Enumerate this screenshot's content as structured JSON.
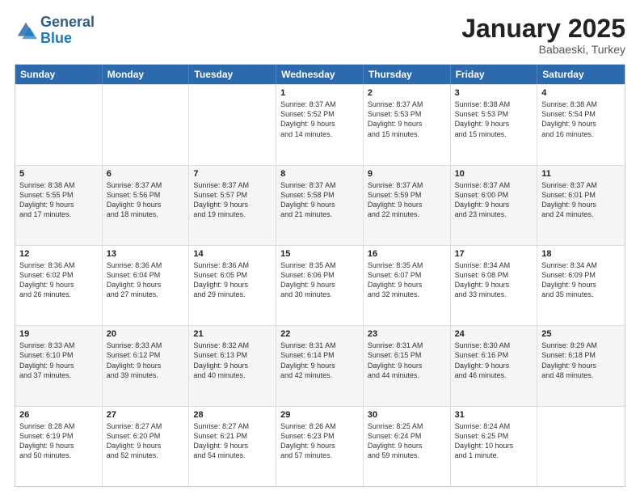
{
  "logo": {
    "general": "General",
    "blue": "Blue"
  },
  "header": {
    "month": "January 2025",
    "location": "Babaeski, Turkey"
  },
  "weekdays": [
    "Sunday",
    "Monday",
    "Tuesday",
    "Wednesday",
    "Thursday",
    "Friday",
    "Saturday"
  ],
  "rows": [
    {
      "alt": false,
      "cells": [
        {
          "day": "",
          "text": ""
        },
        {
          "day": "",
          "text": ""
        },
        {
          "day": "",
          "text": ""
        },
        {
          "day": "1",
          "text": "Sunrise: 8:37 AM\nSunset: 5:52 PM\nDaylight: 9 hours\nand 14 minutes."
        },
        {
          "day": "2",
          "text": "Sunrise: 8:37 AM\nSunset: 5:53 PM\nDaylight: 9 hours\nand 15 minutes."
        },
        {
          "day": "3",
          "text": "Sunrise: 8:38 AM\nSunset: 5:53 PM\nDaylight: 9 hours\nand 15 minutes."
        },
        {
          "day": "4",
          "text": "Sunrise: 8:38 AM\nSunset: 5:54 PM\nDaylight: 9 hours\nand 16 minutes."
        }
      ]
    },
    {
      "alt": true,
      "cells": [
        {
          "day": "5",
          "text": "Sunrise: 8:38 AM\nSunset: 5:55 PM\nDaylight: 9 hours\nand 17 minutes."
        },
        {
          "day": "6",
          "text": "Sunrise: 8:37 AM\nSunset: 5:56 PM\nDaylight: 9 hours\nand 18 minutes."
        },
        {
          "day": "7",
          "text": "Sunrise: 8:37 AM\nSunset: 5:57 PM\nDaylight: 9 hours\nand 19 minutes."
        },
        {
          "day": "8",
          "text": "Sunrise: 8:37 AM\nSunset: 5:58 PM\nDaylight: 9 hours\nand 21 minutes."
        },
        {
          "day": "9",
          "text": "Sunrise: 8:37 AM\nSunset: 5:59 PM\nDaylight: 9 hours\nand 22 minutes."
        },
        {
          "day": "10",
          "text": "Sunrise: 8:37 AM\nSunset: 6:00 PM\nDaylight: 9 hours\nand 23 minutes."
        },
        {
          "day": "11",
          "text": "Sunrise: 8:37 AM\nSunset: 6:01 PM\nDaylight: 9 hours\nand 24 minutes."
        }
      ]
    },
    {
      "alt": false,
      "cells": [
        {
          "day": "12",
          "text": "Sunrise: 8:36 AM\nSunset: 6:02 PM\nDaylight: 9 hours\nand 26 minutes."
        },
        {
          "day": "13",
          "text": "Sunrise: 8:36 AM\nSunset: 6:04 PM\nDaylight: 9 hours\nand 27 minutes."
        },
        {
          "day": "14",
          "text": "Sunrise: 8:36 AM\nSunset: 6:05 PM\nDaylight: 9 hours\nand 29 minutes."
        },
        {
          "day": "15",
          "text": "Sunrise: 8:35 AM\nSunset: 6:06 PM\nDaylight: 9 hours\nand 30 minutes."
        },
        {
          "day": "16",
          "text": "Sunrise: 8:35 AM\nSunset: 6:07 PM\nDaylight: 9 hours\nand 32 minutes."
        },
        {
          "day": "17",
          "text": "Sunrise: 8:34 AM\nSunset: 6:08 PM\nDaylight: 9 hours\nand 33 minutes."
        },
        {
          "day": "18",
          "text": "Sunrise: 8:34 AM\nSunset: 6:09 PM\nDaylight: 9 hours\nand 35 minutes."
        }
      ]
    },
    {
      "alt": true,
      "cells": [
        {
          "day": "19",
          "text": "Sunrise: 8:33 AM\nSunset: 6:10 PM\nDaylight: 9 hours\nand 37 minutes."
        },
        {
          "day": "20",
          "text": "Sunrise: 8:33 AM\nSunset: 6:12 PM\nDaylight: 9 hours\nand 39 minutes."
        },
        {
          "day": "21",
          "text": "Sunrise: 8:32 AM\nSunset: 6:13 PM\nDaylight: 9 hours\nand 40 minutes."
        },
        {
          "day": "22",
          "text": "Sunrise: 8:31 AM\nSunset: 6:14 PM\nDaylight: 9 hours\nand 42 minutes."
        },
        {
          "day": "23",
          "text": "Sunrise: 8:31 AM\nSunset: 6:15 PM\nDaylight: 9 hours\nand 44 minutes."
        },
        {
          "day": "24",
          "text": "Sunrise: 8:30 AM\nSunset: 6:16 PM\nDaylight: 9 hours\nand 46 minutes."
        },
        {
          "day": "25",
          "text": "Sunrise: 8:29 AM\nSunset: 6:18 PM\nDaylight: 9 hours\nand 48 minutes."
        }
      ]
    },
    {
      "alt": false,
      "cells": [
        {
          "day": "26",
          "text": "Sunrise: 8:28 AM\nSunset: 6:19 PM\nDaylight: 9 hours\nand 50 minutes."
        },
        {
          "day": "27",
          "text": "Sunrise: 8:27 AM\nSunset: 6:20 PM\nDaylight: 9 hours\nand 52 minutes."
        },
        {
          "day": "28",
          "text": "Sunrise: 8:27 AM\nSunset: 6:21 PM\nDaylight: 9 hours\nand 54 minutes."
        },
        {
          "day": "29",
          "text": "Sunrise: 8:26 AM\nSunset: 6:23 PM\nDaylight: 9 hours\nand 57 minutes."
        },
        {
          "day": "30",
          "text": "Sunrise: 8:25 AM\nSunset: 6:24 PM\nDaylight: 9 hours\nand 59 minutes."
        },
        {
          "day": "31",
          "text": "Sunrise: 8:24 AM\nSunset: 6:25 PM\nDaylight: 10 hours\nand 1 minute."
        },
        {
          "day": "",
          "text": ""
        }
      ]
    }
  ]
}
